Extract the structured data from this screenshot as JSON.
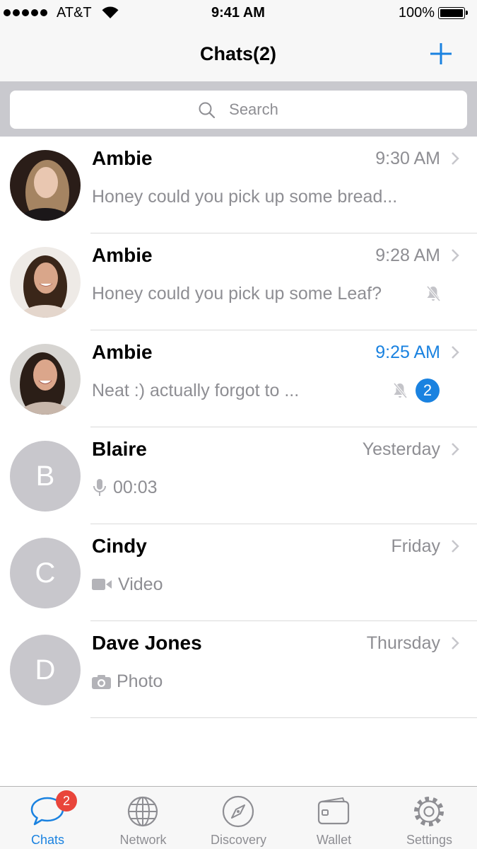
{
  "status_bar": {
    "carrier": "AT&T",
    "time": "9:41 AM",
    "battery": "100%",
    "signal_strength": 5,
    "battery_level": 1.0,
    "wifi_icon": "wifi-icon",
    "battery_icon": "battery-icon"
  },
  "nav": {
    "title": "Chats(2)",
    "action_icon": "plus-icon"
  },
  "search": {
    "placeholder": "Search",
    "icon": "search-icon"
  },
  "chats": [
    {
      "name": "Ambie",
      "time": "9:30 AM",
      "preview": "Honey could you pick up some bread...",
      "has_photo": true,
      "muted": false,
      "unread_count": null
    },
    {
      "name": "Ambie",
      "time": "9:28 AM",
      "preview": "Honey could you pick up some Leaf?",
      "has_photo": true,
      "muted": true,
      "unread_count": null
    },
    {
      "name": "Ambie",
      "time": "9:25 AM",
      "preview": "Neat :) actually forgot to ...",
      "has_photo": true,
      "muted": true,
      "unread_count": "2"
    },
    {
      "name": "Blaire",
      "time": "Yesterday",
      "avatar_letter": "B",
      "preview_icon": "microphone-icon",
      "preview": "00:03",
      "has_photo": false,
      "muted": false
    },
    {
      "name": "Cindy",
      "time": "Friday",
      "avatar_letter": "C",
      "preview_icon": "video-camera-icon",
      "preview": "Video",
      "has_photo": false,
      "muted": false
    },
    {
      "name": "Dave Jones",
      "time": "Thursday",
      "avatar_letter": "D",
      "preview_icon": "camera-icon",
      "preview": "Photo",
      "has_photo": false,
      "muted": false
    }
  ],
  "tabs": [
    {
      "label": "Chats",
      "icon": "chat-bubble-icon",
      "active": true,
      "badge": "2"
    },
    {
      "label": "Network",
      "icon": "globe-icon",
      "active": false
    },
    {
      "label": "Discovery",
      "icon": "compass-icon",
      "active": false
    },
    {
      "label": "Wallet",
      "icon": "wallet-icon",
      "active": false
    },
    {
      "label": "Settings",
      "icon": "gear-icon",
      "active": false
    }
  ],
  "colors": {
    "accent": "#1a82e0",
    "badge_red": "#e9453b",
    "secondary_text": "#8e8e93",
    "avatar_gray": "#c8c7cc",
    "search_background": "#c9c9ce",
    "bar_background": "#f7f7f7"
  }
}
